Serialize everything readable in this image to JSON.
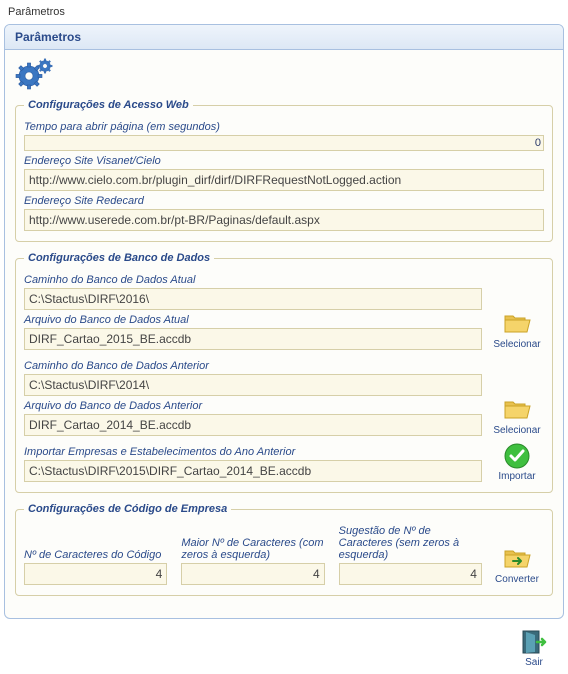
{
  "window": {
    "title": "Parâmetros"
  },
  "panel": {
    "title": "Parâmetros"
  },
  "groups": {
    "web": {
      "legend": "Configurações de Acesso Web",
      "timeout_label": "Tempo para abrir página (em segundos)",
      "timeout_value": "0",
      "visanet_label": "Endereço Site Visanet/Cielo",
      "visanet_value": "http://www.cielo.com.br/plugin_dirf/dirf/DIRFRequestNotLogged.action",
      "redecard_label": "Endereço Site Redecard",
      "redecard_value": "http://www.userede.com.br/pt-BR/Paginas/default.aspx"
    },
    "db": {
      "legend": "Configurações de Banco de Dados",
      "cur_path_label": "Caminho do Banco de Dados Atual",
      "cur_path_value": "C:\\Stactus\\DIRF\\2016\\",
      "cur_file_label": "Arquivo do Banco de Dados Atual",
      "cur_file_value": "DIRF_Cartao_2015_BE.accdb",
      "select_cur_caption": "Selecionar",
      "prev_path_label": "Caminho do Banco de Dados Anterior",
      "prev_path_value": "C:\\Stactus\\DIRF\\2014\\",
      "prev_file_label": "Arquivo do Banco de Dados Anterior",
      "prev_file_value": "DIRF_Cartao_2014_BE.accdb",
      "select_prev_caption": "Selecionar",
      "import_label": "Importar Empresas e Estabelecimentos do Ano Anterior",
      "import_value": "C:\\Stactus\\DIRF\\2015\\DIRF_Cartao_2014_BE.accdb",
      "import_caption": "Importar"
    },
    "codigo": {
      "legend": "Configurações de Código de Empresa",
      "ncar_label": "Nº de Caracteres do Código",
      "ncar_value": "4",
      "maior_label": "Maior Nº de Caracteres (com zeros à esquerda)",
      "maior_value": "4",
      "sugestao_label": "Sugestão de Nº de Caracteres (sem zeros à esquerda)",
      "sugestao_value": "4",
      "convert_caption": "Converter"
    }
  },
  "footer": {
    "exit_caption": "Sair"
  }
}
